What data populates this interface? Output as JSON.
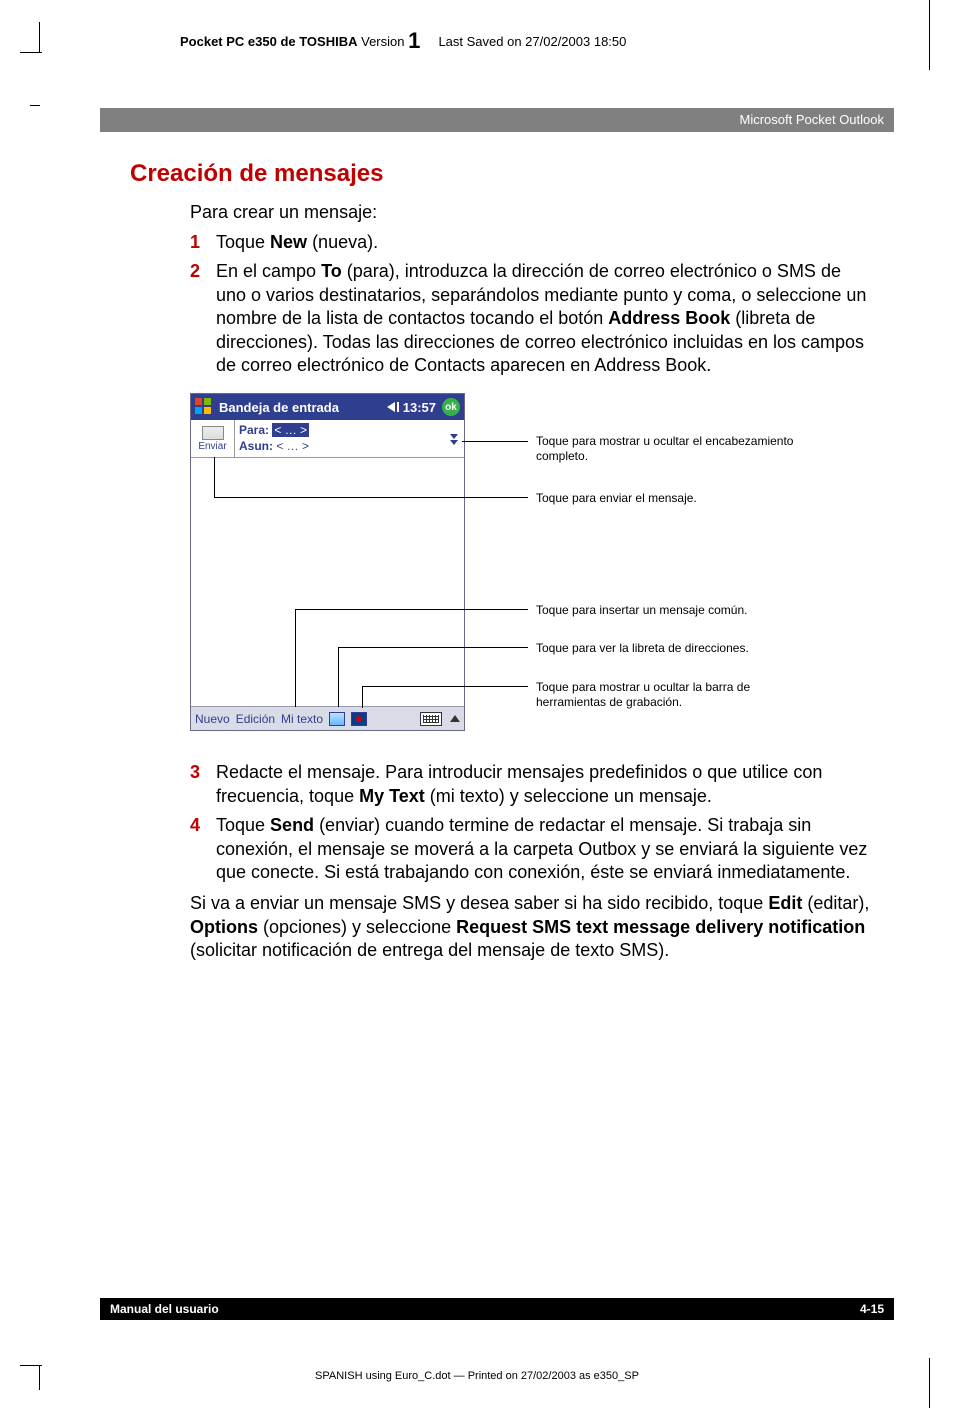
{
  "running_head": {
    "product": "Pocket PC e350 de TOSHIBA",
    "version_label": "Version",
    "version_num": "1",
    "saved": "Last Saved on 27/02/2003 18:50"
  },
  "section_bar": "Microsoft Pocket Outlook",
  "title": "Creación de mensajes",
  "intro": "Para crear un mensaje:",
  "steps": {
    "s1": {
      "num": "1",
      "pre": "Toque ",
      "b1": "New",
      "post": " (nueva)."
    },
    "s2": {
      "num": "2",
      "t1": "En el campo ",
      "b1": "To",
      "t2": " (para), introduzca la dirección de correo electrónico o SMS de uno o varios destinatarios, separándolos mediante punto y coma, o seleccione un nombre de la lista de contactos tocando el botón ",
      "b2": "Address Book",
      "t3": " (libreta de direcciones). Todas las direcciones de correo electrónico incluidas en los campos de correo electrónico de Contacts aparecen en Address Book."
    },
    "s3": {
      "num": "3",
      "t1": "Redacte el mensaje. Para introducir mensajes predefinidos o que utilice con frecuencia, toque ",
      "b1": "My Text",
      "t2": " (mi texto) y seleccione un mensaje."
    },
    "s4": {
      "num": "4",
      "t1": "Toque ",
      "b1": "Send",
      "t2": " (enviar) cuando termine de redactar el mensaje. Si trabaja sin conexión, el mensaje se moverá a la carpeta Outbox y se enviará la siguiente vez que conecte. Si está trabajando con conexión, éste se enviará inmediatamente."
    }
  },
  "closing": {
    "t1": "Si va a enviar un mensaje SMS y desea saber si ha sido recibido, toque ",
    "b1": "Edit",
    "t2": " (editar), ",
    "b2": "Options",
    "t3": " (opciones) y seleccione ",
    "b3": "Request SMS text message delivery notification",
    "t4": " (solicitar notificación de entrega del mensaje de texto SMS)."
  },
  "screenshot": {
    "title": "Bandeja de entrada",
    "clock": "13:57",
    "ok": "ok",
    "send_label": "Enviar",
    "para_label": "Para:",
    "para_value": "< … >",
    "asun_label": "Asun:",
    "asun_value": "< … >",
    "menu": {
      "nuevo": "Nuevo",
      "edicion": "Edición",
      "mitexto": "Mi texto"
    }
  },
  "callouts": {
    "c1": "Toque para mostrar u ocultar el encabezamiento completo.",
    "c2": "Toque para enviar el mensaje.",
    "c3": "Toque para insertar un mensaje común.",
    "c4": "Toque para ver la libreta de direcciones.",
    "c5a": "Toque para mostrar u ocultar la barra de",
    "c5b": "herramientas de grabación."
  },
  "footer": {
    "left": "Manual del usuario",
    "right": "4-15"
  },
  "print_line": "SPANISH using  Euro_C.dot — Printed on 27/02/2003 as e350_SP"
}
